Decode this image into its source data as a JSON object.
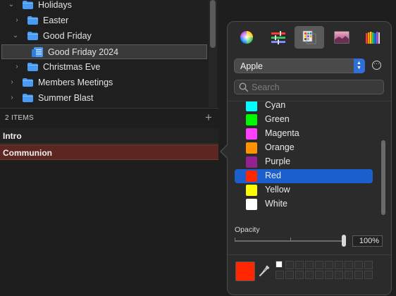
{
  "tree": {
    "items": [
      {
        "label": "Holidays",
        "expanded": true
      },
      {
        "label": "Easter",
        "expanded": false
      },
      {
        "label": "Good Friday",
        "expanded": true
      },
      {
        "label": "Good Friday 2024",
        "selected": true
      },
      {
        "label": "Christmas Eve",
        "expanded": false
      },
      {
        "label": "Members Meetings",
        "expanded": false
      },
      {
        "label": "Summer Blast",
        "expanded": false
      }
    ]
  },
  "items_panel": {
    "count_label": "2 ITEMS",
    "add_icon": "plus-icon",
    "items": [
      {
        "label": "Intro",
        "selected": false
      },
      {
        "label": "Communion",
        "selected": true
      }
    ]
  },
  "color_panel": {
    "tabs": [
      {
        "icon": "color-wheel-icon",
        "active": false
      },
      {
        "icon": "color-sliders-icon",
        "active": false
      },
      {
        "icon": "color-palettes-icon",
        "active": true
      },
      {
        "icon": "image-palettes-icon",
        "active": false
      },
      {
        "icon": "pencils-icon",
        "active": false
      }
    ],
    "palette_selected": "Apple",
    "more_icon": "ellipsis-circle-icon",
    "search_placeholder": "Search",
    "colors": [
      {
        "name": "Cyan",
        "hex": "#00fdff"
      },
      {
        "name": "Green",
        "hex": "#00f900"
      },
      {
        "name": "Magenta",
        "hex": "#ff40ff"
      },
      {
        "name": "Orange",
        "hex": "#ff9300"
      },
      {
        "name": "Purple",
        "hex": "#942192"
      },
      {
        "name": "Red",
        "hex": "#ff2600",
        "selected": true
      },
      {
        "name": "Yellow",
        "hex": "#fffb00"
      },
      {
        "name": "White",
        "hex": "#ffffff"
      }
    ],
    "opacity_label": "Opacity",
    "opacity_value": "100%",
    "current_color_hex": "#ff2600",
    "selection_color_hex": "#1b5fcf"
  }
}
